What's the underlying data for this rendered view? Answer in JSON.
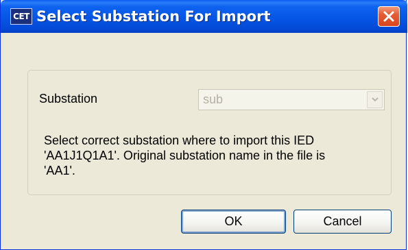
{
  "window": {
    "icon_text": "CET",
    "title": "Select Substation For Import"
  },
  "form": {
    "substation_label": "Substation",
    "substation_value": "sub",
    "message_lines": [
      "Select correct substation where to import this IED",
      "'AA1J1Q1A1'. Original substation name in the file is",
      "'AA1'."
    ]
  },
  "buttons": {
    "ok_label": "OK",
    "cancel_label": "Cancel"
  },
  "colors": {
    "titlebar": "#0554e3",
    "dialog_bg": "#ece9d8",
    "close_button": "#e45c35"
  },
  "icons": {
    "close": "close-icon",
    "dropdown": "chevron-down-icon",
    "app": "app-icon"
  }
}
